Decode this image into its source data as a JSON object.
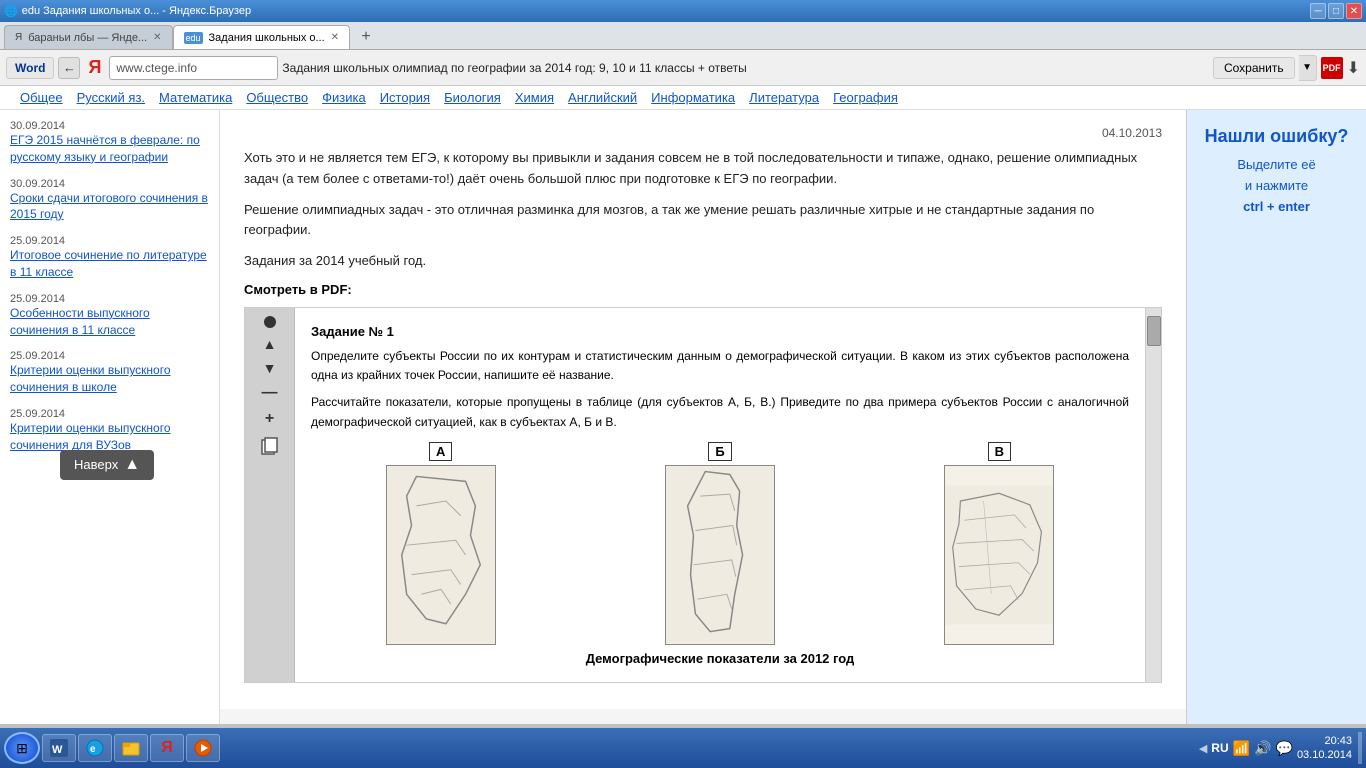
{
  "window": {
    "title": "edu Задания школьных о... - Яндекс.Браузер"
  },
  "titlebar": {
    "controls": [
      "minimize",
      "maximize",
      "close"
    ]
  },
  "tabs": [
    {
      "id": "tab1",
      "label": "бараньи лбы — Янде...",
      "active": false,
      "favicon": "Я"
    },
    {
      "id": "tab2",
      "label": "Задания школьных о...",
      "active": true,
      "favicon": "edu"
    }
  ],
  "address_bar": {
    "word_label": "Word",
    "back_icon": "←",
    "yandex_icon": "Я",
    "url": "www.ctege.info",
    "page_title": "Задания школьных олимпиад по географии за 2014 год: 9, 10 и 11 классы + ответы",
    "save_label": "Сохранить",
    "dropdown_icon": "▼",
    "pdf_icon": "PDF",
    "download_icon": "⬇"
  },
  "nav_menu": {
    "items": [
      "Общее",
      "Русский яз.",
      "Математика",
      "Общество",
      "Физика",
      "История",
      "Биология",
      "Химия",
      "Английский",
      "Информатика",
      "Литература",
      "География"
    ]
  },
  "sidebar": {
    "items": [
      {
        "date": "30.09.2014",
        "link": "ЕГЭ 2015 начнётся в феврале: по русскому языку и географии"
      },
      {
        "date": "30.09.2014",
        "link": "Сроки сдачи итогового сочинения в 2015 году"
      },
      {
        "date": "25.09.2014",
        "link": "Итоговое сочинение по литературе в 11 классе"
      },
      {
        "date": "25.09.2014",
        "link": "Особенности выпускного сочинения в 11 классе"
      },
      {
        "date": "25.09.2014",
        "link": "Критерии оценки выпускного сочинения в школе"
      },
      {
        "date": "25.09.2014",
        "link": "Критерии оценки выпускного сочинения для ВУЗов"
      }
    ],
    "back_to_top": "Наверх"
  },
  "content": {
    "date": "04.10.2013",
    "paragraphs": [
      "Хоть это и не является тем ЕГЭ, к которому вы привыкли и задания совсем не в той последовательности и типаже, однако, решение олимпиадных задач (а тем более с ответами-то!) даёт очень большой плюс при подготовке к ЕГЭ по географии.",
      "Решение олимпиадных задач - это отличная разминка для мозгов, а так же умение решать различные хитрые и не стандартные задания по географии.",
      "Задания за 2014 учебный год."
    ],
    "smotret_label": "Смотреть в PDF:",
    "pdf_task": {
      "task_num": "Задание № 1",
      "task_text_1": "Определите субъекты России по их контурам и статистическим данным о демографической ситуации. В каком из этих субъектов расположена одна из крайних точек России, напишите её название.",
      "task_text_2": "Рассчитайте показатели, которые пропущены в таблице (для субъектов А, Б, В.) Приведите по два примера субъектов России с аналогичной демографической ситуацией, как в субъектах А, Б и В.",
      "maps": [
        {
          "label": "А"
        },
        {
          "label": "Б"
        },
        {
          "label": "В"
        }
      ],
      "caption": "Демографические показатели за 2012 год"
    }
  },
  "right_panel": {
    "title": "Нашли ошибку?",
    "line1": "Выделите её",
    "line2": "и нажмите",
    "shortcut": "ctrl + enter"
  },
  "taskbar": {
    "lang": "RU",
    "time": "20:43",
    "date": "03.10.2014",
    "icons": [
      "⊞",
      "IE",
      "📁",
      "Я",
      "▶"
    ]
  }
}
